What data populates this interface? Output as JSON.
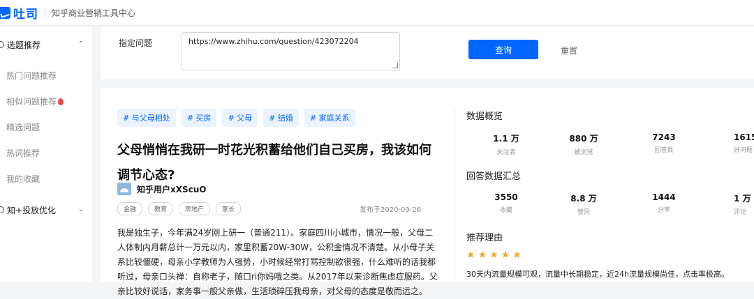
{
  "header": {
    "logo": "吐司",
    "subtitle": "知乎商业营销工具中心"
  },
  "sidebar": {
    "group1": {
      "label": "选题推荐",
      "chevron": "⌃"
    },
    "items": [
      {
        "label": "热门问题推荐"
      },
      {
        "label": "相似问题推荐"
      },
      {
        "label": "精选问题"
      },
      {
        "label": "热词推荐"
      },
      {
        "label": "我的收藏"
      }
    ],
    "group2": {
      "label": "知+投放优化",
      "chevron": "⌄"
    }
  },
  "query": {
    "label": "指定问题",
    "url": "https://www.zhihu.com/question/423072204",
    "query_button": "查询",
    "reset_button": "重置"
  },
  "question": {
    "tags": [
      "# 与父母相处",
      "# 买房",
      "# 父母",
      "# 结婚",
      "# 家庭关系"
    ],
    "title": "父母悄悄在我研一时花光积蓄给他们自己买房，我该如何调节心态?",
    "author": "知乎用户xXScuO",
    "meta_tags": [
      "金融",
      "教育",
      "房地产",
      "家长"
    ],
    "published": "发布于2020-09-26",
    "body": "我是独生子，今年满24岁刚上研一（普通211）。家庭四川小城市，情况一般，父母二人体制内月薪总计一万元以内，家里积蓄20W-30W，公积金情况不清楚。从小母子关系比较僵硬，母亲小学教师为人强势，小时候经常打骂控制欲很强，什么难听的话我都听过，母亲口头禅：自称老子，随口ri你妈哦之类。从2017年以来诊断焦虑症服药。父亲比较好说话，家务事一般父亲做，生活琐碎压我母亲，对父母的态度是敬而远之。"
  },
  "overview": {
    "title": "数据概览",
    "stats": [
      {
        "value": "1.1 万",
        "label": "关注者"
      },
      {
        "value": "880 万",
        "label": "被浏览"
      },
      {
        "value": "7243",
        "label": "回答数"
      },
      {
        "value": "1615",
        "label": "好问题"
      }
    ]
  },
  "answers": {
    "title": "回答数据汇总",
    "stats": [
      {
        "value": "3550",
        "label": "收藏"
      },
      {
        "value": "8.8 万",
        "label": "赞同"
      },
      {
        "value": "1444",
        "label": "分享"
      },
      {
        "value": "1 万",
        "label": "评论"
      }
    ]
  },
  "recommend": {
    "title": "推荐理由",
    "stars": 5,
    "reason": "30天内流量规模可观，流量中长期稳定，近24h流量规模尚佳，点击率极高。"
  },
  "colors": {
    "accent": "#0066ff",
    "star": "#f5a623"
  }
}
